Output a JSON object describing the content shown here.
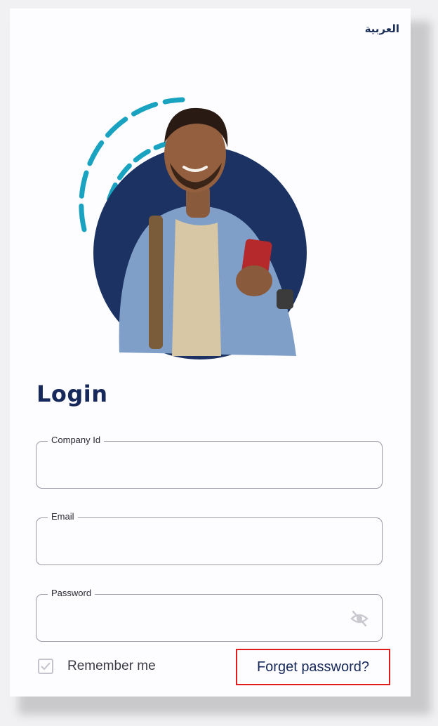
{
  "header": {
    "language_toggle": "العربية"
  },
  "login": {
    "title": "Login",
    "fields": {
      "company_id": {
        "label": "Company Id",
        "value": ""
      },
      "email": {
        "label": "Email",
        "value": ""
      },
      "password": {
        "label": "Password",
        "value": ""
      }
    },
    "remember_me": {
      "label": "Remember me",
      "checked": true
    },
    "forgot_password": "Forget password?"
  },
  "colors": {
    "brand_navy": "#17285a",
    "accent_teal": "#1aa3c0",
    "highlight_red": "#e21b1b"
  }
}
